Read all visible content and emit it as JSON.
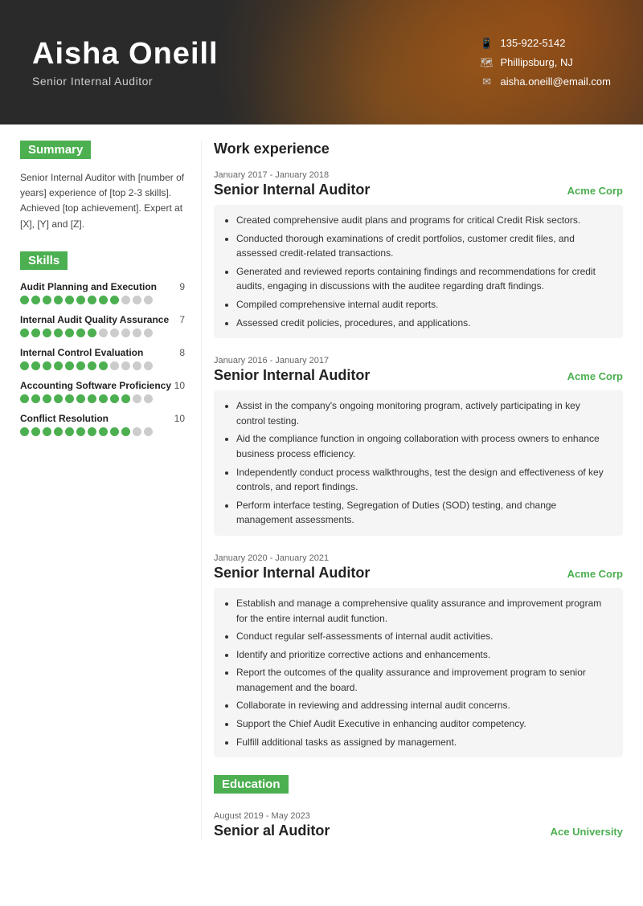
{
  "header": {
    "name": "Aisha Oneill",
    "title": "Senior Internal Auditor",
    "phone": "135-922-5142",
    "location": "Phillipsburg, NJ",
    "email": "aisha.oneill@email.com"
  },
  "summary": {
    "label": "Summary",
    "text": "Senior Internal Auditor with [number of years] experience of [top 2-3 skills]. Achieved [top achievement]. Expert at [X], [Y] and [Z]."
  },
  "skills": {
    "label": "Skills",
    "items": [
      {
        "name": "Audit Planning and Execution",
        "score": 9,
        "filled": 9,
        "total": 12
      },
      {
        "name": "Internal Audit Quality Assurance",
        "score": 7,
        "filled": 7,
        "total": 12
      },
      {
        "name": "Internal Control Evaluation",
        "score": 8,
        "filled": 8,
        "total": 12
      },
      {
        "name": "Accounting Software Proficiency",
        "score": 10,
        "filled": 10,
        "total": 12
      },
      {
        "name": "Conflict Resolution",
        "score": 10,
        "filled": 10,
        "total": 12
      }
    ]
  },
  "work_experience": {
    "label": "Work experience",
    "entries": [
      {
        "date": "January 2017 - January 2018",
        "title": "Senior Internal Auditor",
        "company": "Acme Corp",
        "bullets": [
          "Created comprehensive audit plans and programs for critical Credit Risk sectors.",
          "Conducted thorough examinations of credit portfolios, customer credit files, and assessed credit-related transactions.",
          "Generated and reviewed reports containing findings and recommendations for credit audits, engaging in discussions with the auditee regarding draft findings.",
          "Compiled comprehensive internal audit reports.",
          "Assessed credit policies, procedures, and applications."
        ]
      },
      {
        "date": "January 2016 - January 2017",
        "title": "Senior Internal Auditor",
        "company": "Acme Corp",
        "bullets": [
          "Assist in the company's ongoing monitoring program, actively participating in key control testing.",
          "Aid the compliance function in ongoing collaboration with process owners to enhance business process efficiency.",
          "Independently conduct process walkthroughs, test the design and effectiveness of key controls, and report findings.",
          "Perform interface testing, Segregation of Duties (SOD) testing, and change management assessments."
        ]
      },
      {
        "date": "January 2020 - January 2021",
        "title": "Senior Internal Auditor",
        "company": "Acme Corp",
        "bullets": [
          "Establish and manage a comprehensive quality assurance and improvement program for the entire internal audit function.",
          "Conduct regular self-assessments of internal audit activities.",
          "Identify and prioritize corrective actions and enhancements.",
          "Report the outcomes of the quality assurance and improvement program to senior management and the board.",
          "Collaborate in reviewing and addressing internal audit concerns.",
          "Support the Chief Audit Executive in enhancing auditor competency.",
          "Fulfill additional tasks as assigned by management."
        ]
      }
    ]
  },
  "education": {
    "label": "Education",
    "entries": [
      {
        "date": "August 2019 - May 2023",
        "degree": "Senior al Auditor",
        "school": "Ace University"
      }
    ]
  }
}
